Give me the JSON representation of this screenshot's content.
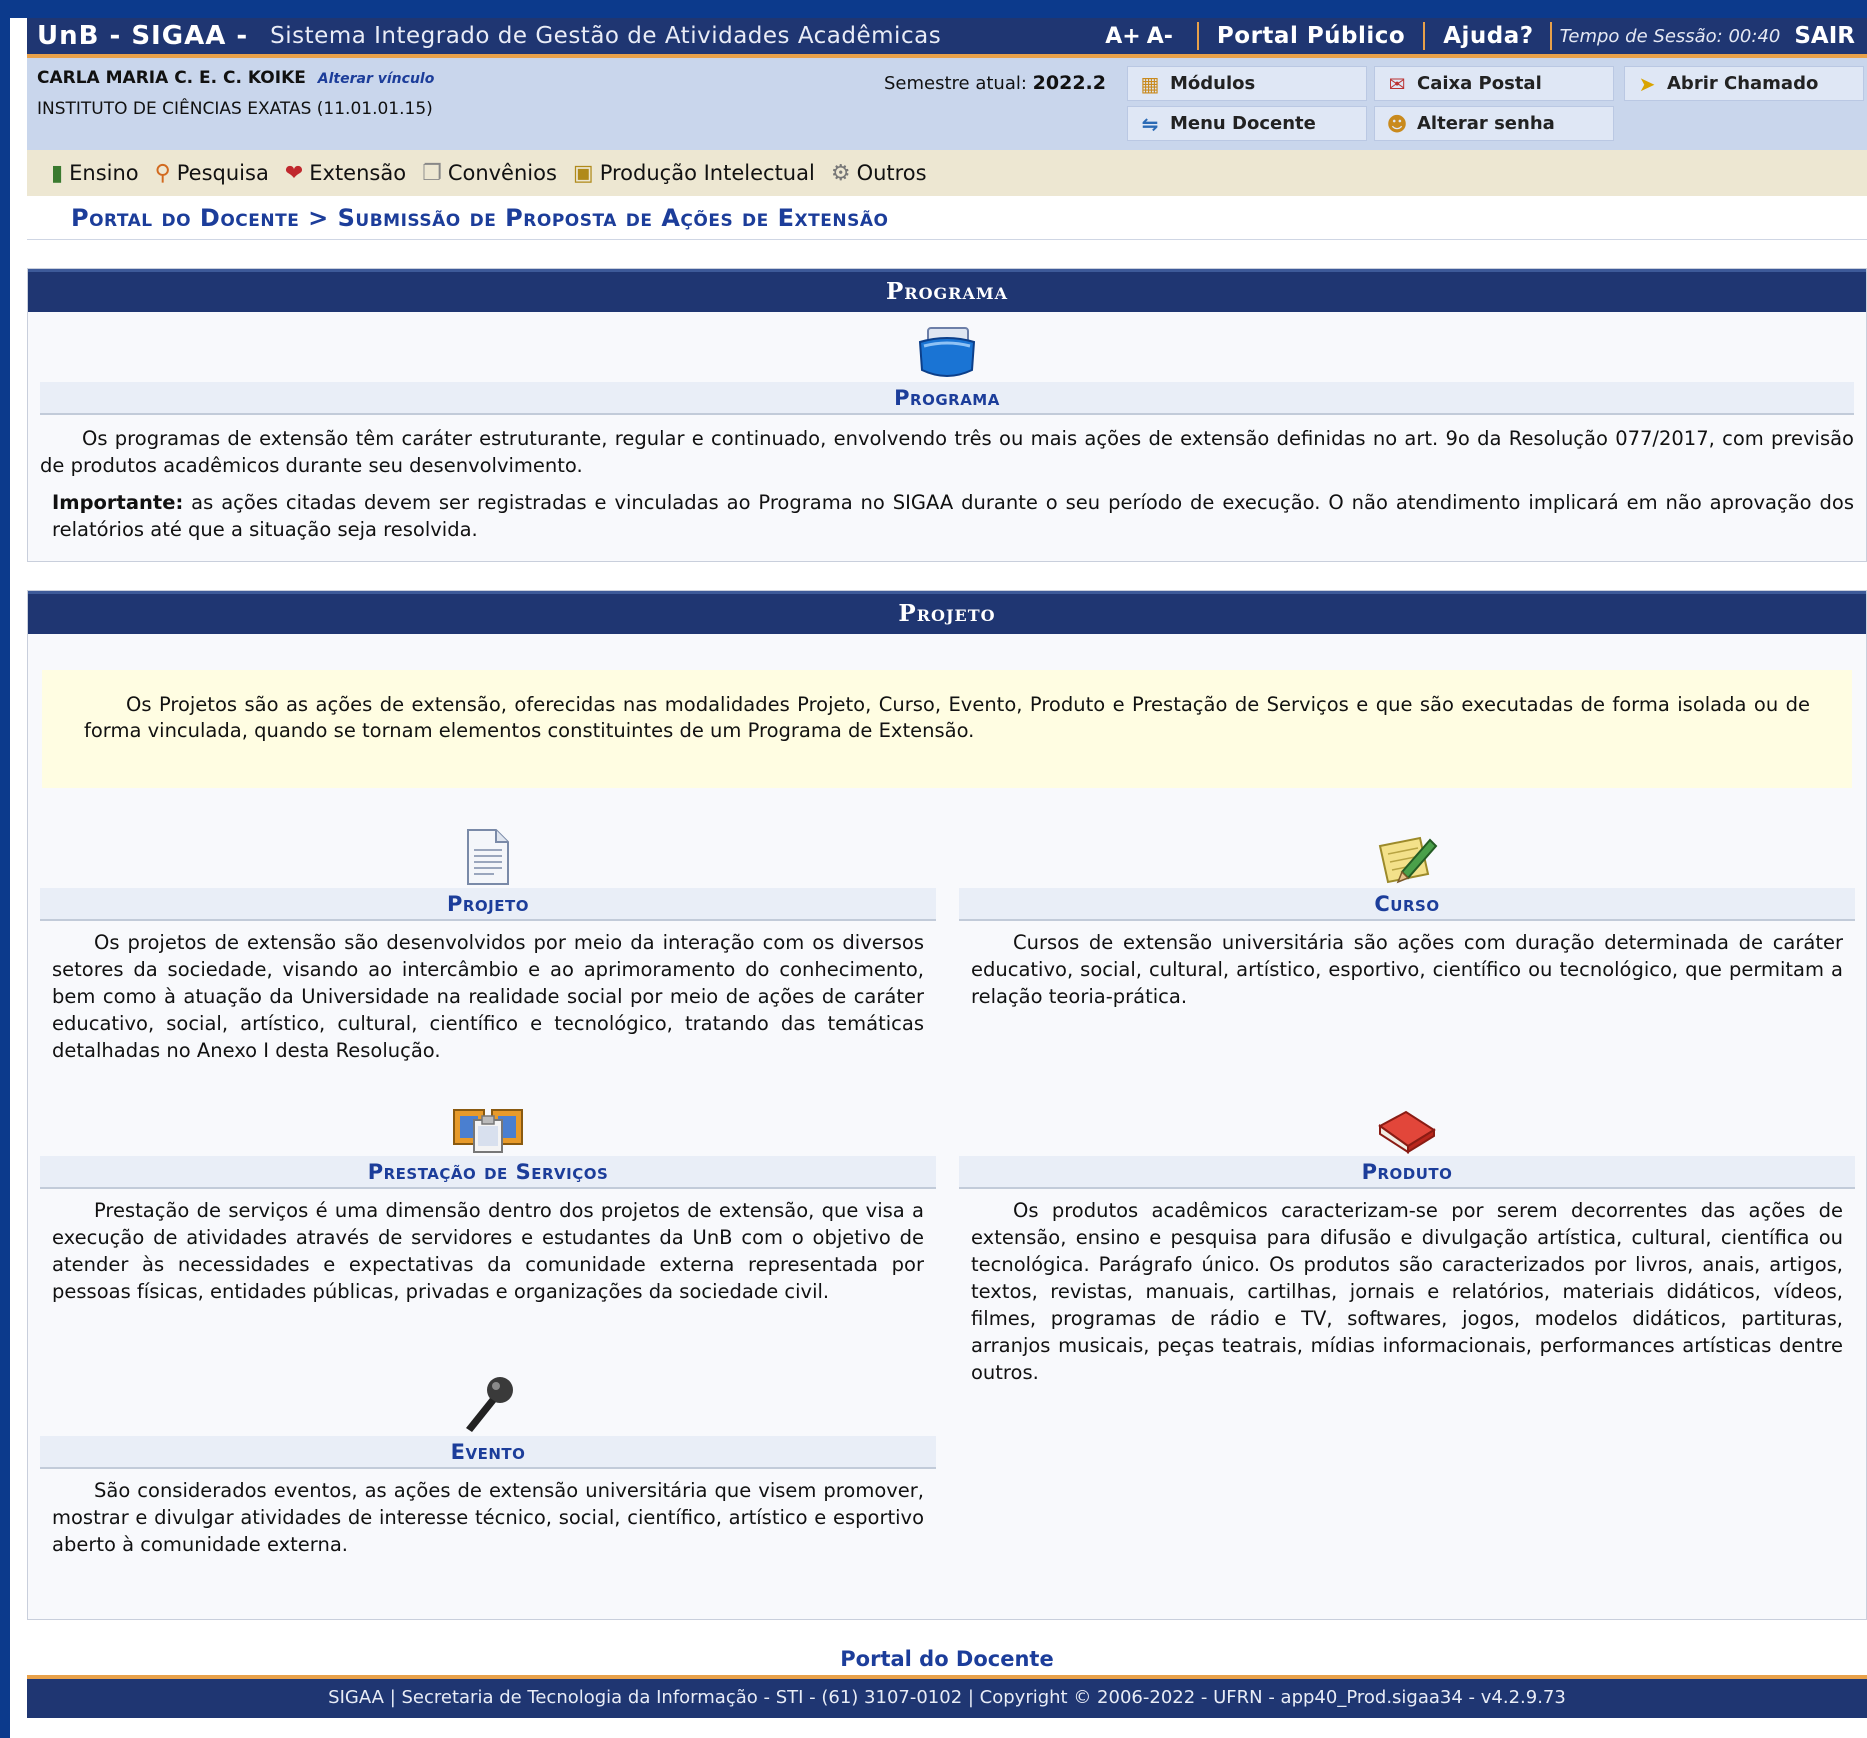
{
  "header": {
    "brand": "UnB - SIGAA -",
    "system_name": "Sistema Integrado de Gestão de Atividades Acadêmicas",
    "font_increase": "A+",
    "font_decrease": "A-",
    "portal_publico": "Portal Público",
    "ajuda": "Ajuda?",
    "session": "Tempo de Sessão: 00:40",
    "sair": "SAIR"
  },
  "user": {
    "name": "CARLA MARIA C. E. C. KOIKE",
    "alterar_vinculo": "Alterar vínculo",
    "unit": "INSTITUTO DE CIÊNCIAS EXATAS (11.01.01.15)",
    "semestre_label": "Semestre atual:",
    "semestre_value": "2022.2"
  },
  "quick_buttons": {
    "modulos": "Módulos",
    "caixa_postal": "Caixa Postal",
    "abrir_chamado": "Abrir Chamado",
    "menu_docente": "Menu Docente",
    "alterar_senha": "Alterar senha"
  },
  "menu": [
    {
      "label": "Ensino",
      "icon": "books-icon"
    },
    {
      "label": "Pesquisa",
      "icon": "flask-icon"
    },
    {
      "label": "Extensão",
      "icon": "heart-hands-icon"
    },
    {
      "label": "Convênios",
      "icon": "documents-icon"
    },
    {
      "label": "Produção Intelectual",
      "icon": "notebook-icon"
    },
    {
      "label": "Outros",
      "icon": "gears-icon"
    }
  ],
  "breadcrumb": "Portal do Docente > Submissão de Proposta de Ações de Extensão",
  "programa_section": {
    "title": "Programa",
    "item_title": "Programa",
    "text": "Os programas de extensão têm caráter estruturante, regular e continuado, envolvendo três ou mais ações de extensão definidas no art. 9o da Resolução 077/2017, com previsão de produtos acadêmicos durante seu desenvolvimento.",
    "important_label": "Importante:",
    "important_text": " as ações citadas devem ser registradas e vinculadas ao Programa no SIGAA durante o seu período de execução. O não atendimento implicará em não aprovação dos relatórios até que a situação seja resolvida."
  },
  "projeto_section": {
    "title": "Projeto",
    "note": "Os Projetos são as ações de extensão, oferecidas nas modalidades Projeto, Curso, Evento, Produto e Prestação de Serviços e que são executadas de forma isolada ou de forma vinculada, quando se tornam elementos constituintes de um Programa de Extensão.",
    "items": {
      "projeto": {
        "title": "Projeto",
        "text": "Os projetos de extensão são desenvolvidos por meio da interação com os diversos setores da sociedade, visando ao intercâmbio e ao aprimoramento do conhecimento, bem como à atuação da Universidade na realidade social por meio de ações de caráter educativo, social, artístico, cultural, científico e tecnológico, tratando das temáticas detalhadas no Anexo I desta Resolução."
      },
      "curso": {
        "title": "Curso",
        "text": "Cursos de extensão universitária são ações com duração determinada de caráter educativo, social, cultural, artístico, esportivo, científico ou tecnológico, que permitam a relação teoria-prática."
      },
      "prestacao": {
        "title": "Prestação de Serviços",
        "text": "Prestação de serviços é uma dimensão dentro dos projetos de extensão, que visa a execução de atividades através de servidores e estudantes da UnB com o objetivo de atender às necessidades e expectativas da comunidade externa representada por pessoas físicas, entidades públicas, privadas e organizações da sociedade civil."
      },
      "produto": {
        "title": "Produto",
        "text": "Os produtos acadêmicos caracterizam-se por serem decorrentes das ações de extensão, ensino e pesquisa para difusão e divulgação artística, cultural, científica ou tecnológica. Parágrafo único. Os produtos são caracterizados por livros, anais, artigos, textos, revistas, manuais, cartilhas, jornais e relatórios, materiais didáticos, vídeos, filmes, programas de rádio e TV, softwares, jogos, modelos didáticos, partituras, arranjos musicais, peças teatrais, mídias informacionais, performances artísticas dentre outros."
      },
      "evento": {
        "title": "Evento",
        "text": "São considerados eventos, as ações de extensão universitária que visem promover, mostrar e divulgar atividades de interesse técnico, social, científico, artístico e esportivo aberto à comunidade externa."
      }
    }
  },
  "footer": {
    "portal_link": "Portal do Docente",
    "text": "SIGAA | Secretaria de Tecnologia da Informação - STI - (61) 3107-0102 | Copyright © 2006-2022 - UFRN - app40_Prod.sigaa34 - v4.2.9.73"
  },
  "colors": {
    "header_bg": "#1f3672",
    "accent_orange": "#e8a14a",
    "link_blue": "#1c3d9a",
    "info_bg": "#c9d6ec",
    "menu_bg": "#ede7d2",
    "note_bg": "#fffde2"
  }
}
